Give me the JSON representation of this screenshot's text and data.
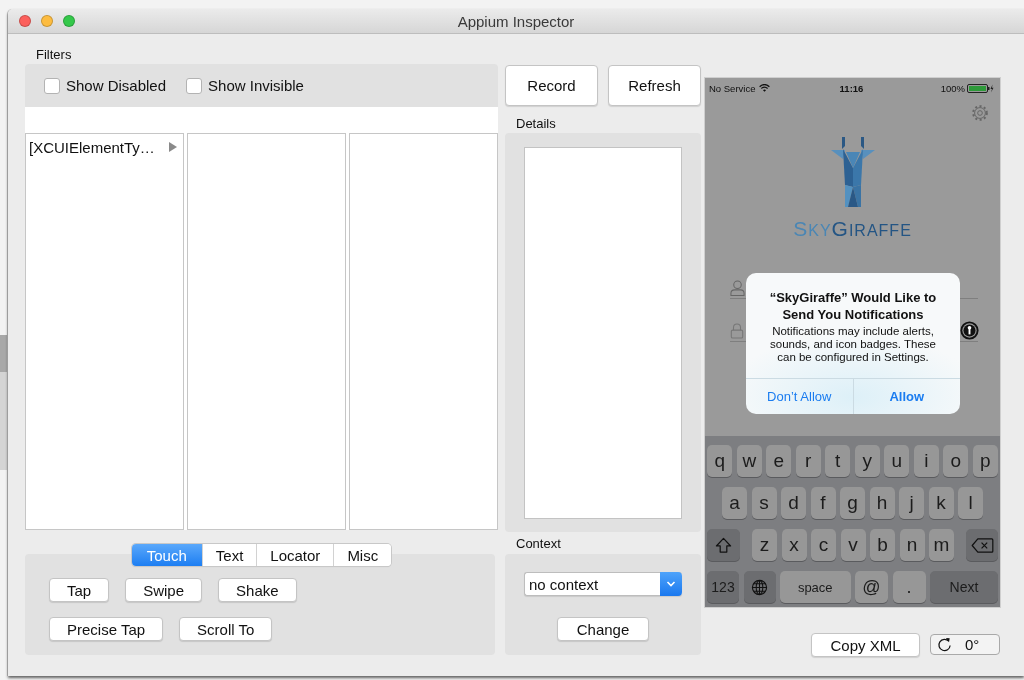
{
  "window": {
    "title": "Appium Inspector"
  },
  "filters": {
    "label": "Filters",
    "checkboxes": [
      {
        "label": "Show Disabled",
        "checked": false
      },
      {
        "label": "Show Invisible",
        "checked": false
      }
    ]
  },
  "toolbar": {
    "buttons": [
      "Record",
      "Refresh"
    ]
  },
  "element_tree": {
    "items": [
      {
        "label": "[XCUIElementTy…",
        "expandable": true
      }
    ]
  },
  "actions": {
    "tabs": [
      {
        "label": "Touch",
        "selected": true
      },
      {
        "label": "Text",
        "selected": false
      },
      {
        "label": "Locator",
        "selected": false
      },
      {
        "label": "Misc",
        "selected": false
      }
    ],
    "button_rows": [
      [
        "Tap",
        "Swipe",
        "Shake"
      ],
      [
        "Precise Tap",
        "Scroll To"
      ]
    ]
  },
  "details": {
    "label": "Details"
  },
  "context": {
    "label": "Context",
    "dropdown": {
      "value": "no context"
    },
    "button": "Change"
  },
  "device_screen": {
    "status_bar": {
      "carrier": "No Service",
      "time": "11:16",
      "battery": "100%"
    },
    "logo_text": [
      "SKY",
      "GIRAFFE"
    ],
    "alert": {
      "title": "“SkyGiraffe” Would Like to Send You Notifications",
      "message": "Notifications may include alerts, sounds, and icon badges. These can be configured in Settings.",
      "buttons": [
        {
          "label": "Don’t Allow",
          "preferred": false
        },
        {
          "label": "Allow",
          "preferred": true
        }
      ]
    },
    "keyboard": {
      "rows": [
        {
          "keys": [
            {
              "kind": "char",
              "label": "q"
            },
            {
              "kind": "char",
              "label": "w"
            },
            {
              "kind": "char",
              "label": "e"
            },
            {
              "kind": "char",
              "label": "r"
            },
            {
              "kind": "char",
              "label": "t"
            },
            {
              "kind": "char",
              "label": "y"
            },
            {
              "kind": "char",
              "label": "u"
            },
            {
              "kind": "char",
              "label": "i"
            },
            {
              "kind": "char",
              "label": "o"
            },
            {
              "kind": "char",
              "label": "p"
            }
          ]
        },
        {
          "keys": [
            {
              "kind": "char",
              "label": "a"
            },
            {
              "kind": "char",
              "label": "s"
            },
            {
              "kind": "char",
              "label": "d"
            },
            {
              "kind": "char",
              "label": "f"
            },
            {
              "kind": "char",
              "label": "g"
            },
            {
              "kind": "char",
              "label": "h"
            },
            {
              "kind": "char",
              "label": "j"
            },
            {
              "kind": "char",
              "label": "k"
            },
            {
              "kind": "char",
              "label": "l"
            }
          ]
        },
        {
          "keys": [
            {
              "kind": "shift"
            },
            {
              "kind": "char",
              "label": "z"
            },
            {
              "kind": "char",
              "label": "x"
            },
            {
              "kind": "char",
              "label": "c"
            },
            {
              "kind": "char",
              "label": "v"
            },
            {
              "kind": "char",
              "label": "b"
            },
            {
              "kind": "char",
              "label": "n"
            },
            {
              "kind": "char",
              "label": "m"
            },
            {
              "kind": "delete"
            }
          ]
        },
        {
          "keys": [
            {
              "kind": "mode",
              "label": "123"
            },
            {
              "kind": "globe"
            },
            {
              "kind": "space",
              "label": "space"
            },
            {
              "kind": "symbol",
              "label": "@"
            },
            {
              "kind": "symbol",
              "label": "."
            },
            {
              "kind": "next",
              "label": "Next"
            }
          ]
        }
      ]
    }
  },
  "footer": {
    "copy_button": "Copy XML",
    "rotation": "0°"
  }
}
